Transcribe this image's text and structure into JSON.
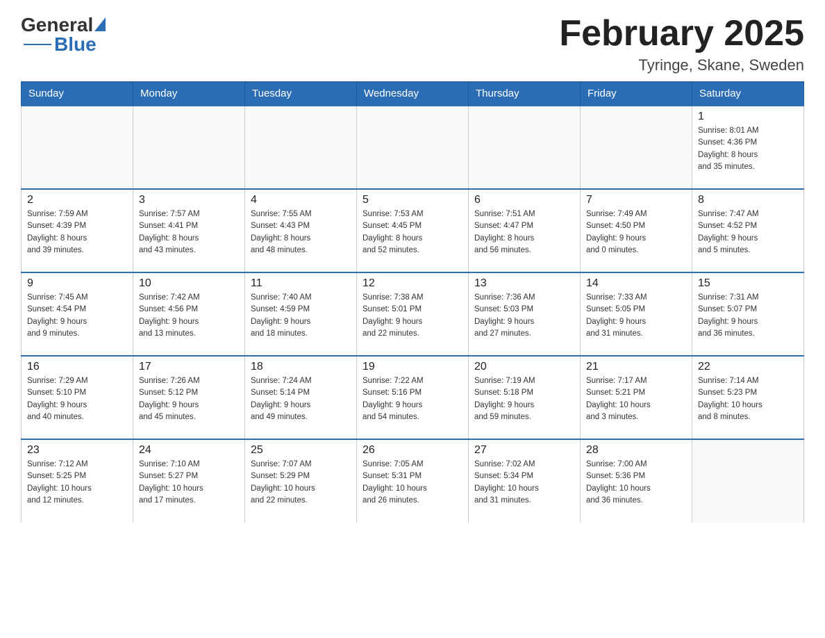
{
  "header": {
    "logo_general": "General",
    "logo_blue": "Blue",
    "title": "February 2025",
    "subtitle": "Tyringe, Skane, Sweden"
  },
  "days_of_week": [
    "Sunday",
    "Monday",
    "Tuesday",
    "Wednesday",
    "Thursday",
    "Friday",
    "Saturday"
  ],
  "weeks": [
    [
      {
        "day": "",
        "info": ""
      },
      {
        "day": "",
        "info": ""
      },
      {
        "day": "",
        "info": ""
      },
      {
        "day": "",
        "info": ""
      },
      {
        "day": "",
        "info": ""
      },
      {
        "day": "",
        "info": ""
      },
      {
        "day": "1",
        "info": "Sunrise: 8:01 AM\nSunset: 4:36 PM\nDaylight: 8 hours\nand 35 minutes."
      }
    ],
    [
      {
        "day": "2",
        "info": "Sunrise: 7:59 AM\nSunset: 4:39 PM\nDaylight: 8 hours\nand 39 minutes."
      },
      {
        "day": "3",
        "info": "Sunrise: 7:57 AM\nSunset: 4:41 PM\nDaylight: 8 hours\nand 43 minutes."
      },
      {
        "day": "4",
        "info": "Sunrise: 7:55 AM\nSunset: 4:43 PM\nDaylight: 8 hours\nand 48 minutes."
      },
      {
        "day": "5",
        "info": "Sunrise: 7:53 AM\nSunset: 4:45 PM\nDaylight: 8 hours\nand 52 minutes."
      },
      {
        "day": "6",
        "info": "Sunrise: 7:51 AM\nSunset: 4:47 PM\nDaylight: 8 hours\nand 56 minutes."
      },
      {
        "day": "7",
        "info": "Sunrise: 7:49 AM\nSunset: 4:50 PM\nDaylight: 9 hours\nand 0 minutes."
      },
      {
        "day": "8",
        "info": "Sunrise: 7:47 AM\nSunset: 4:52 PM\nDaylight: 9 hours\nand 5 minutes."
      }
    ],
    [
      {
        "day": "9",
        "info": "Sunrise: 7:45 AM\nSunset: 4:54 PM\nDaylight: 9 hours\nand 9 minutes."
      },
      {
        "day": "10",
        "info": "Sunrise: 7:42 AM\nSunset: 4:56 PM\nDaylight: 9 hours\nand 13 minutes."
      },
      {
        "day": "11",
        "info": "Sunrise: 7:40 AM\nSunset: 4:59 PM\nDaylight: 9 hours\nand 18 minutes."
      },
      {
        "day": "12",
        "info": "Sunrise: 7:38 AM\nSunset: 5:01 PM\nDaylight: 9 hours\nand 22 minutes."
      },
      {
        "day": "13",
        "info": "Sunrise: 7:36 AM\nSunset: 5:03 PM\nDaylight: 9 hours\nand 27 minutes."
      },
      {
        "day": "14",
        "info": "Sunrise: 7:33 AM\nSunset: 5:05 PM\nDaylight: 9 hours\nand 31 minutes."
      },
      {
        "day": "15",
        "info": "Sunrise: 7:31 AM\nSunset: 5:07 PM\nDaylight: 9 hours\nand 36 minutes."
      }
    ],
    [
      {
        "day": "16",
        "info": "Sunrise: 7:29 AM\nSunset: 5:10 PM\nDaylight: 9 hours\nand 40 minutes."
      },
      {
        "day": "17",
        "info": "Sunrise: 7:26 AM\nSunset: 5:12 PM\nDaylight: 9 hours\nand 45 minutes."
      },
      {
        "day": "18",
        "info": "Sunrise: 7:24 AM\nSunset: 5:14 PM\nDaylight: 9 hours\nand 49 minutes."
      },
      {
        "day": "19",
        "info": "Sunrise: 7:22 AM\nSunset: 5:16 PM\nDaylight: 9 hours\nand 54 minutes."
      },
      {
        "day": "20",
        "info": "Sunrise: 7:19 AM\nSunset: 5:18 PM\nDaylight: 9 hours\nand 59 minutes."
      },
      {
        "day": "21",
        "info": "Sunrise: 7:17 AM\nSunset: 5:21 PM\nDaylight: 10 hours\nand 3 minutes."
      },
      {
        "day": "22",
        "info": "Sunrise: 7:14 AM\nSunset: 5:23 PM\nDaylight: 10 hours\nand 8 minutes."
      }
    ],
    [
      {
        "day": "23",
        "info": "Sunrise: 7:12 AM\nSunset: 5:25 PM\nDaylight: 10 hours\nand 12 minutes."
      },
      {
        "day": "24",
        "info": "Sunrise: 7:10 AM\nSunset: 5:27 PM\nDaylight: 10 hours\nand 17 minutes."
      },
      {
        "day": "25",
        "info": "Sunrise: 7:07 AM\nSunset: 5:29 PM\nDaylight: 10 hours\nand 22 minutes."
      },
      {
        "day": "26",
        "info": "Sunrise: 7:05 AM\nSunset: 5:31 PM\nDaylight: 10 hours\nand 26 minutes."
      },
      {
        "day": "27",
        "info": "Sunrise: 7:02 AM\nSunset: 5:34 PM\nDaylight: 10 hours\nand 31 minutes."
      },
      {
        "day": "28",
        "info": "Sunrise: 7:00 AM\nSunset: 5:36 PM\nDaylight: 10 hours\nand 36 minutes."
      },
      {
        "day": "",
        "info": ""
      }
    ]
  ]
}
